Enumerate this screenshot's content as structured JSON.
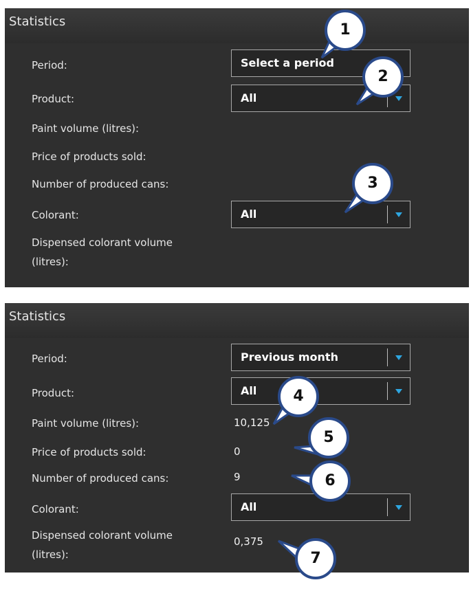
{
  "panels": [
    {
      "title": "Statistics",
      "labels": {
        "period": "Period:",
        "product": "Product:",
        "paint_volume": "Paint volume (litres):",
        "price_sold": "Price of products sold:",
        "produced_cans": "Number of produced cans:",
        "colorant": "Colorant:",
        "dispensed_1": "Dispensed colorant volume",
        "dispensed_2": "(litres):"
      },
      "period_value": "Select a period",
      "product_value": "All",
      "colorant_value": "All"
    },
    {
      "title": "Statistics",
      "labels": {
        "period": "Period:",
        "product": "Product:",
        "paint_volume": "Paint volume (litres):",
        "price_sold": "Price of products sold:",
        "produced_cans": "Number of produced cans:",
        "colorant": "Colorant:",
        "dispensed_1": "Dispensed colorant volume",
        "dispensed_2": "(litres):"
      },
      "period_value": "Previous month",
      "product_value": "All",
      "colorant_value": "All",
      "paint_volume_value": "10,125",
      "price_sold_value": "0",
      "produced_cans_value": "9",
      "dispensed_value": "0,375"
    }
  ],
  "callouts": [
    "1",
    "2",
    "3",
    "4",
    "5",
    "6",
    "7"
  ],
  "colors": {
    "panel_bg": "#2f2f2f",
    "dropdown_arrow": "#2ea6e0",
    "callout_fill": "#ffffff",
    "callout_border": "#2a4a8a"
  }
}
